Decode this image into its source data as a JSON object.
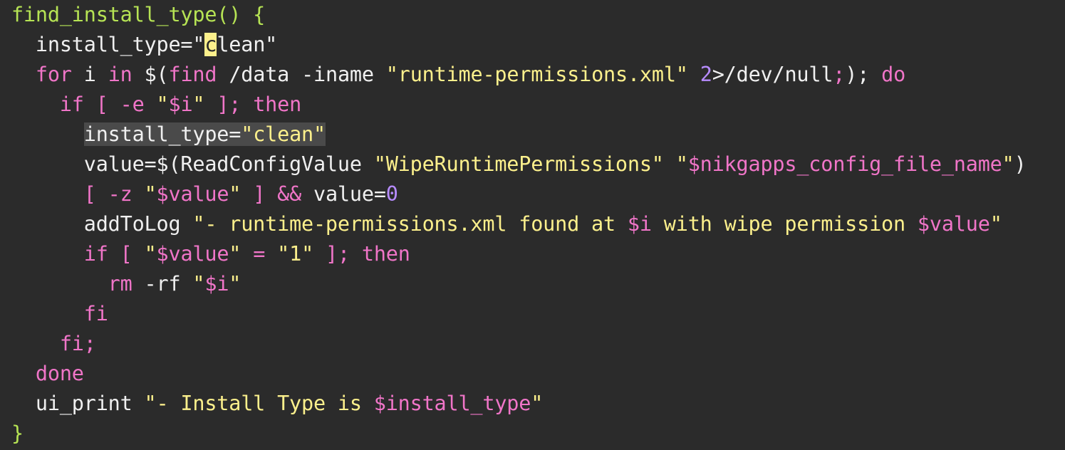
{
  "editor": {
    "background": "#2b2b2b",
    "colors": {
      "function": "#b6e354",
      "keyword": "#f075c8",
      "string": "#fcf08c",
      "variable": "#f075c8",
      "number": "#b78cff",
      "plain": "#f0f0f0",
      "cursor": "#fcf08c",
      "selection": "#4a4a4a"
    },
    "lines": [
      {
        "tokens": [
          {
            "text": "find_install_type() {",
            "kind": "fn"
          }
        ]
      },
      {
        "tokens": [
          {
            "text": "  install_type=\"",
            "kind": "plain"
          },
          {
            "text": "c",
            "kind": "cursor"
          },
          {
            "text": "lean\"",
            "kind": "plain"
          }
        ]
      },
      {
        "tokens": [
          {
            "text": "  ",
            "kind": "plain"
          },
          {
            "text": "for",
            "kind": "kw"
          },
          {
            "text": " i ",
            "kind": "plain"
          },
          {
            "text": "in",
            "kind": "kw"
          },
          {
            "text": " $(",
            "kind": "plain"
          },
          {
            "text": "find",
            "kind": "kw"
          },
          {
            "text": " /data -iname ",
            "kind": "plain"
          },
          {
            "text": "\"runtime-permissions.xml\"",
            "kind": "str"
          },
          {
            "text": " ",
            "kind": "plain"
          },
          {
            "text": "2",
            "kind": "num"
          },
          {
            "text": ">/dev/null",
            "kind": "plain"
          },
          {
            "text": ";",
            "kind": "kw"
          },
          {
            "text": "); ",
            "kind": "plain"
          },
          {
            "text": "do",
            "kind": "kw"
          }
        ]
      },
      {
        "tokens": [
          {
            "text": "    ",
            "kind": "plain"
          },
          {
            "text": "if [ -e ",
            "kind": "kw"
          },
          {
            "text": "\"",
            "kind": "str"
          },
          {
            "text": "$i",
            "kind": "var"
          },
          {
            "text": "\"",
            "kind": "str"
          },
          {
            "text": " ]; then",
            "kind": "kw"
          }
        ]
      },
      {
        "tokens": [
          {
            "text": "      ",
            "kind": "plain"
          },
          {
            "text": "install_type=",
            "kind": "selplain"
          },
          {
            "text": "\"clean\"",
            "kind": "selstr"
          }
        ]
      },
      {
        "tokens": [
          {
            "text": "      value=$(ReadConfigValue ",
            "kind": "plain"
          },
          {
            "text": "\"WipeRuntimePermissions\"",
            "kind": "str"
          },
          {
            "text": " ",
            "kind": "plain"
          },
          {
            "text": "\"",
            "kind": "str"
          },
          {
            "text": "$nikgapps_config_file_name",
            "kind": "var"
          },
          {
            "text": "\"",
            "kind": "str"
          },
          {
            "text": ")",
            "kind": "plain"
          }
        ]
      },
      {
        "tokens": [
          {
            "text": "      ",
            "kind": "plain"
          },
          {
            "text": "[ -z ",
            "kind": "kw"
          },
          {
            "text": "\"",
            "kind": "str"
          },
          {
            "text": "$value",
            "kind": "var"
          },
          {
            "text": "\"",
            "kind": "str"
          },
          {
            "text": " ] && ",
            "kind": "kw"
          },
          {
            "text": "value=",
            "kind": "plain"
          },
          {
            "text": "0",
            "kind": "num"
          }
        ]
      },
      {
        "tokens": [
          {
            "text": "      addToLog ",
            "kind": "plain"
          },
          {
            "text": "\"- runtime-permissions.xml found at ",
            "kind": "str"
          },
          {
            "text": "$i",
            "kind": "var"
          },
          {
            "text": " with wipe permission ",
            "kind": "str"
          },
          {
            "text": "$value",
            "kind": "var"
          },
          {
            "text": "\"",
            "kind": "str"
          }
        ]
      },
      {
        "tokens": [
          {
            "text": "      ",
            "kind": "plain"
          },
          {
            "text": "if [ ",
            "kind": "kw"
          },
          {
            "text": "\"",
            "kind": "str"
          },
          {
            "text": "$value",
            "kind": "var"
          },
          {
            "text": "\"",
            "kind": "str"
          },
          {
            "text": " = ",
            "kind": "kw"
          },
          {
            "text": "\"1\"",
            "kind": "str"
          },
          {
            "text": " ]; then",
            "kind": "kw"
          }
        ]
      },
      {
        "tokens": [
          {
            "text": "        ",
            "kind": "plain"
          },
          {
            "text": "rm",
            "kind": "kw"
          },
          {
            "text": " -rf ",
            "kind": "plain"
          },
          {
            "text": "\"",
            "kind": "str"
          },
          {
            "text": "$i",
            "kind": "var"
          },
          {
            "text": "\"",
            "kind": "str"
          }
        ]
      },
      {
        "tokens": [
          {
            "text": "      ",
            "kind": "plain"
          },
          {
            "text": "fi",
            "kind": "kw"
          }
        ]
      },
      {
        "tokens": [
          {
            "text": "    ",
            "kind": "plain"
          },
          {
            "text": "fi;",
            "kind": "kw"
          }
        ]
      },
      {
        "tokens": [
          {
            "text": "  ",
            "kind": "plain"
          },
          {
            "text": "done",
            "kind": "kw"
          }
        ]
      },
      {
        "tokens": [
          {
            "text": "  ui_print ",
            "kind": "plain"
          },
          {
            "text": "\"- Install Type is ",
            "kind": "str"
          },
          {
            "text": "$install_type",
            "kind": "var"
          },
          {
            "text": "\"",
            "kind": "str"
          }
        ]
      },
      {
        "tokens": [
          {
            "text": "}",
            "kind": "fn"
          }
        ]
      }
    ]
  }
}
